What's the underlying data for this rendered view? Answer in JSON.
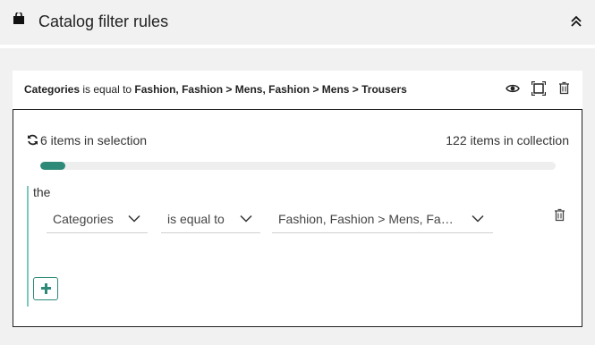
{
  "header": {
    "title": "Catalog filter rules",
    "bag_icon": "shopping-bag-icon",
    "collapse_icon": "chevron-double-up-icon"
  },
  "rule": {
    "field": "Categories",
    "operator": "is equal to",
    "value": "Fashion, Fashion > Mens, Fashion > Mens > Trousers",
    "icons": [
      "eye-icon",
      "frame-icon",
      "trash-icon"
    ]
  },
  "stats": {
    "selection_text": "6 items in selection",
    "collection_text": "122 items in collection",
    "selected": 6,
    "total": 122,
    "progress_fraction": 0.049
  },
  "group": {
    "label": "the",
    "condition": {
      "field": "Categories",
      "operator": "is equal to",
      "value": "Fashion, Fashion > Mens, Fashion > Mens > Trousers",
      "value_display": "Fashion, Fashion > Mens, Fas..."
    },
    "add_icon": "plus-icon"
  },
  "colors": {
    "accent": "#2d8a78",
    "accent_light": "#7fc7bb",
    "background": "#f1f1f1"
  }
}
